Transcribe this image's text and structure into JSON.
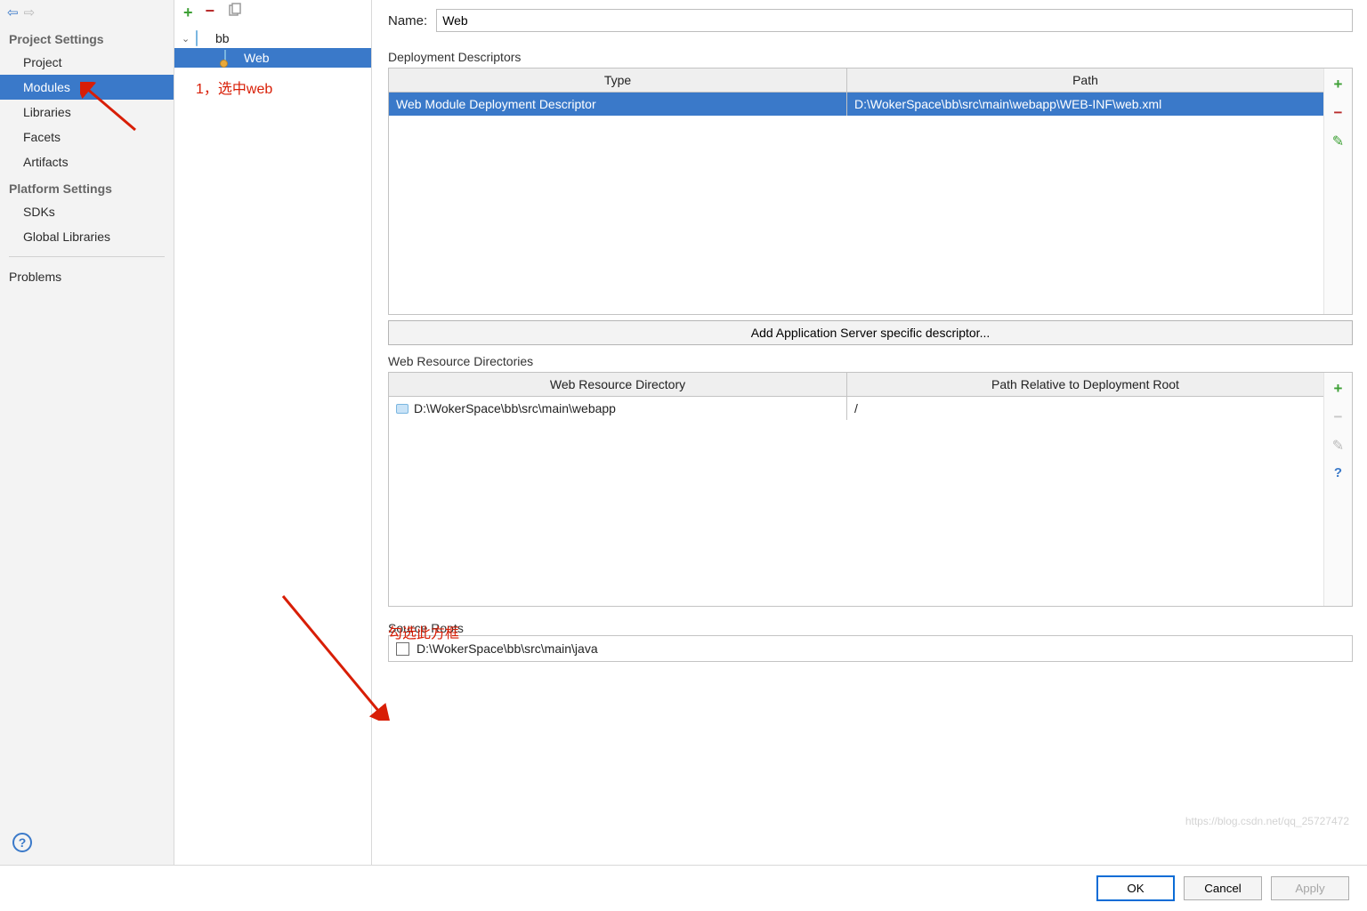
{
  "sidebar": {
    "project_settings_label": "Project Settings",
    "platform_settings_label": "Platform Settings",
    "items": [
      {
        "label": "Project"
      },
      {
        "label": "Modules"
      },
      {
        "label": "Libraries"
      },
      {
        "label": "Facets"
      },
      {
        "label": "Artifacts"
      }
    ],
    "platform": [
      {
        "label": "SDKs"
      },
      {
        "label": "Global Libraries"
      }
    ],
    "problems_label": "Problems"
  },
  "tree": {
    "root_label": "bb",
    "child_label": "Web"
  },
  "annotations": {
    "select_web": "1，选中web",
    "check_box": "勾选此方框"
  },
  "right": {
    "name_label": "Name:",
    "name_value": "Web",
    "dd_label": "Deployment Descriptors",
    "dd_cols": {
      "type": "Type",
      "path": "Path"
    },
    "dd_row": {
      "type": "Web Module Deployment Descriptor",
      "path": "D:\\WokerSpace\\bb\\src\\main\\webapp\\WEB-INF\\web.xml"
    },
    "add_app_btn": "Add Application Server specific descriptor...",
    "wrd_label": "Web Resource Directories",
    "wrd_cols": {
      "dir": "Web Resource Directory",
      "rel": "Path Relative to Deployment Root"
    },
    "wrd_row": {
      "dir": "D:\\WokerSpace\\bb\\src\\main\\webapp",
      "rel": "/"
    },
    "sr_label": "Source Roots",
    "sr_path": "D:\\WokerSpace\\bb\\src\\main\\java"
  },
  "footer": {
    "ok": "OK",
    "cancel": "Cancel",
    "apply": "Apply"
  }
}
